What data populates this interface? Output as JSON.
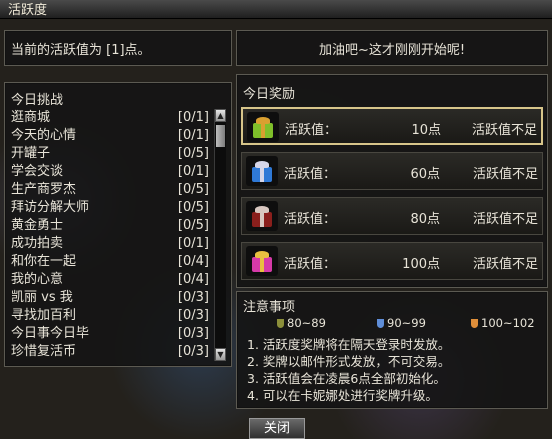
{
  "window": {
    "title": "活跃度"
  },
  "current": {
    "text": "当前的活跃值为 [1]点。"
  },
  "message": {
    "text": "加油吧~这才刚刚开始呢!"
  },
  "challenges": {
    "header": "今日挑战",
    "items": [
      {
        "name": "逛商城",
        "progress": "[0/1]"
      },
      {
        "name": "今天的心情",
        "progress": "[0/1]"
      },
      {
        "name": "开罐子",
        "progress": "[0/5]"
      },
      {
        "name": "学会交谈",
        "progress": "[0/1]"
      },
      {
        "name": "生产商罗杰",
        "progress": "[0/5]"
      },
      {
        "name": "拜访分解大师",
        "progress": "[0/5]"
      },
      {
        "name": "黄金勇士",
        "progress": "[0/5]"
      },
      {
        "name": "成功拍卖",
        "progress": "[0/1]"
      },
      {
        "name": "和你在一起",
        "progress": "[0/4]"
      },
      {
        "name": "我的心意",
        "progress": "[0/4]"
      },
      {
        "name": "凯丽 vs 我",
        "progress": "[0/3]"
      },
      {
        "name": "寻找加百利",
        "progress": "[0/3]"
      },
      {
        "name": "今日事今日毕",
        "progress": "[0/3]"
      },
      {
        "name": "珍惜复活币",
        "progress": "[0/3]"
      }
    ]
  },
  "rewards": {
    "header": "今日奖励",
    "items": [
      {
        "label": "活跃值：",
        "value": "10点",
        "status": "活跃值不足",
        "icon": "gift-green-icon",
        "color": "#7fbf2a",
        "bow": "#d9a030"
      },
      {
        "label": "活跃值：",
        "value": "60点",
        "status": "活跃值不足",
        "icon": "gift-blue-icon",
        "color": "#2f79d6",
        "bow": "#d6d6e8"
      },
      {
        "label": "活跃值：",
        "value": "80点",
        "status": "活跃值不足",
        "icon": "gift-red-icon",
        "color": "#8a1f1c",
        "bow": "#d8c7c0"
      },
      {
        "label": "活跃值：",
        "value": "100点",
        "status": "活跃值不足",
        "icon": "gift-pink-icon",
        "color": "#d63aa8",
        "bow": "#e8c040"
      }
    ]
  },
  "notes": {
    "header": "注意事项",
    "medals": [
      {
        "range": "80~89",
        "icon": "bronze-medal-icon",
        "color": "#8c8f3a"
      },
      {
        "range": "90~99",
        "icon": "silver-medal-icon",
        "color": "#5f8ed8"
      },
      {
        "range": "100~102",
        "icon": "gold-medal-icon",
        "color": "#e08f3a"
      }
    ],
    "lines": [
      "1. 活跃度奖牌将在隔天登录时发放。",
      "2. 奖牌以邮件形式发放，不可交易。",
      "3. 活跃值会在凌晨6点全部初始化。",
      "4. 可以在卡妮娜处进行奖牌升级。"
    ]
  },
  "close_label": "关闭"
}
